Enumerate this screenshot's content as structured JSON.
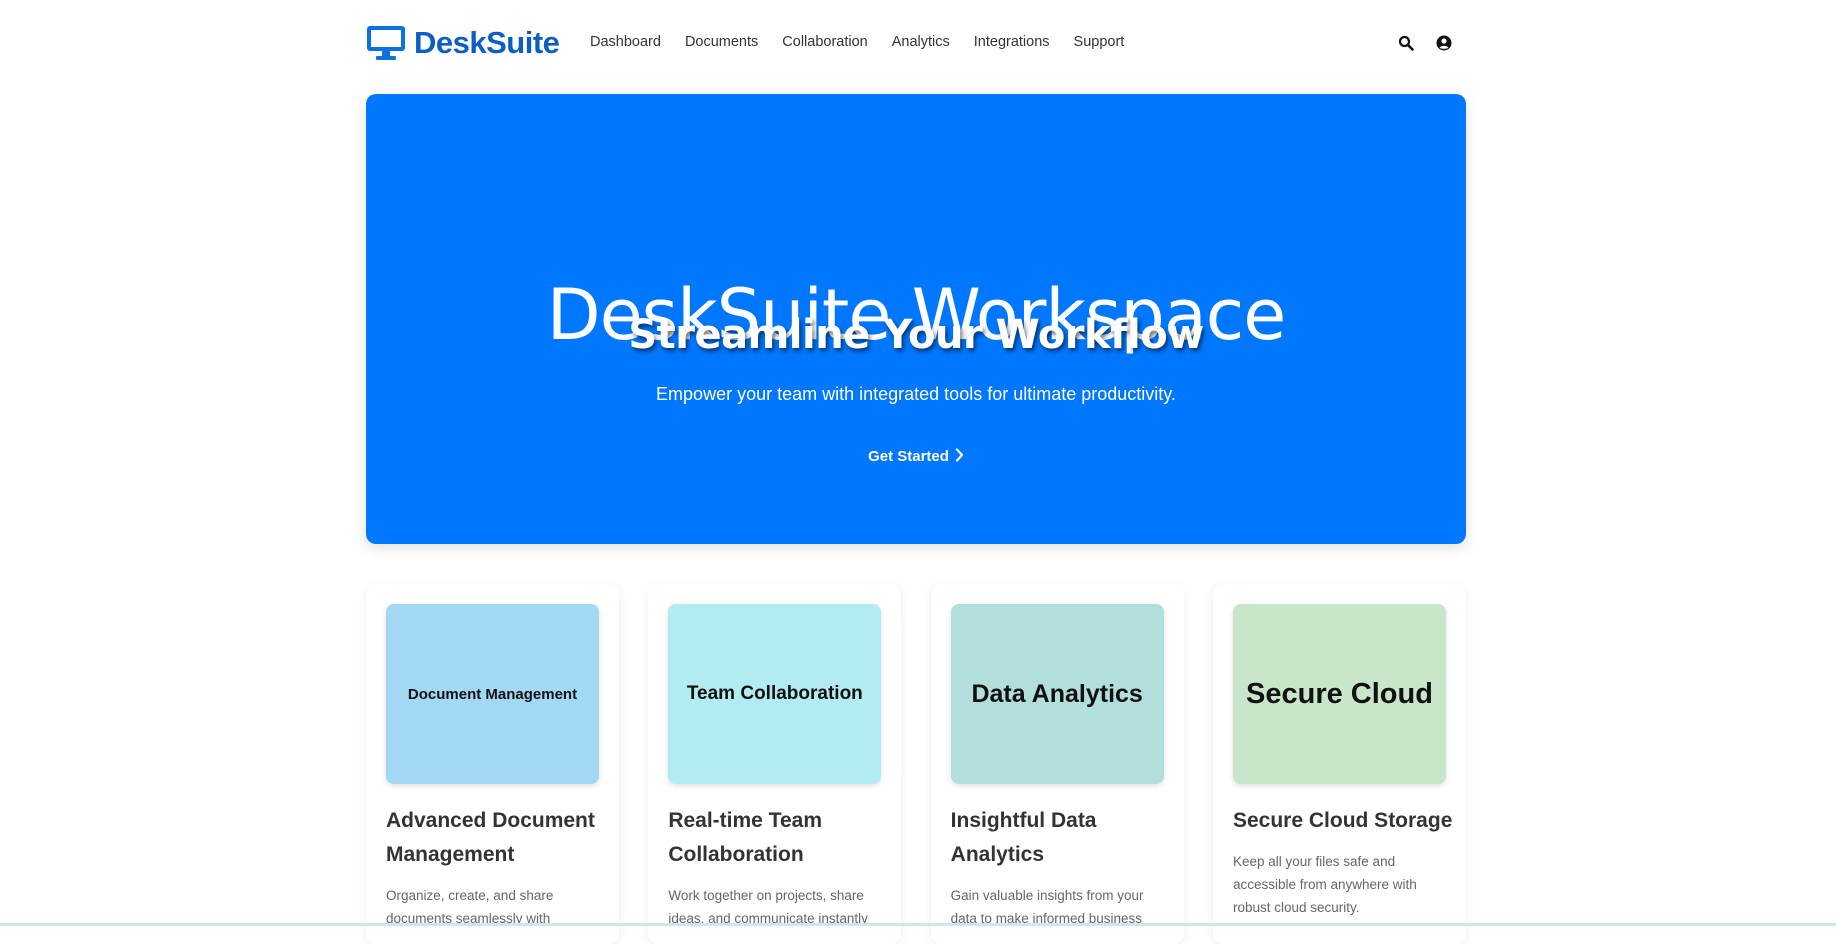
{
  "brand": {
    "name": "DeskSuite",
    "color": "#0b5fc4"
  },
  "nav": [
    {
      "label": "Dashboard"
    },
    {
      "label": "Documents"
    },
    {
      "label": "Collaboration"
    },
    {
      "label": "Analytics"
    },
    {
      "label": "Integrations"
    },
    {
      "label": "Support"
    }
  ],
  "header_icons": [
    "search-icon",
    "user-icon"
  ],
  "hero": {
    "title": "DeskSuite Workspace",
    "subtitle": "Streamline Your Workflow",
    "description": "Empower your team with integrated tools for ultimate productivity.",
    "cta_label": "Get Started",
    "background": "#0077ff"
  },
  "cards": [
    {
      "image_label": "Document Management",
      "image_color": "#a2d8f4",
      "title": "Advanced Document Management",
      "description": "Organize, create, and share documents seamlessly with"
    },
    {
      "image_label": "Team Collaboration",
      "image_color": "#b2ebf2",
      "title": "Real-time Team Collaboration",
      "description": "Work together on projects, share ideas, and communicate instantly"
    },
    {
      "image_label": "Data Analytics",
      "image_color": "#b2dfdb",
      "title": "Insightful Data Analytics",
      "description": "Gain valuable insights from your data to make informed business"
    },
    {
      "image_label": "Secure Cloud",
      "image_color": "#c8e6c9",
      "title": "Secure Cloud Storage",
      "description": "Keep all your files safe and accessible from anywhere with robust cloud security."
    }
  ]
}
